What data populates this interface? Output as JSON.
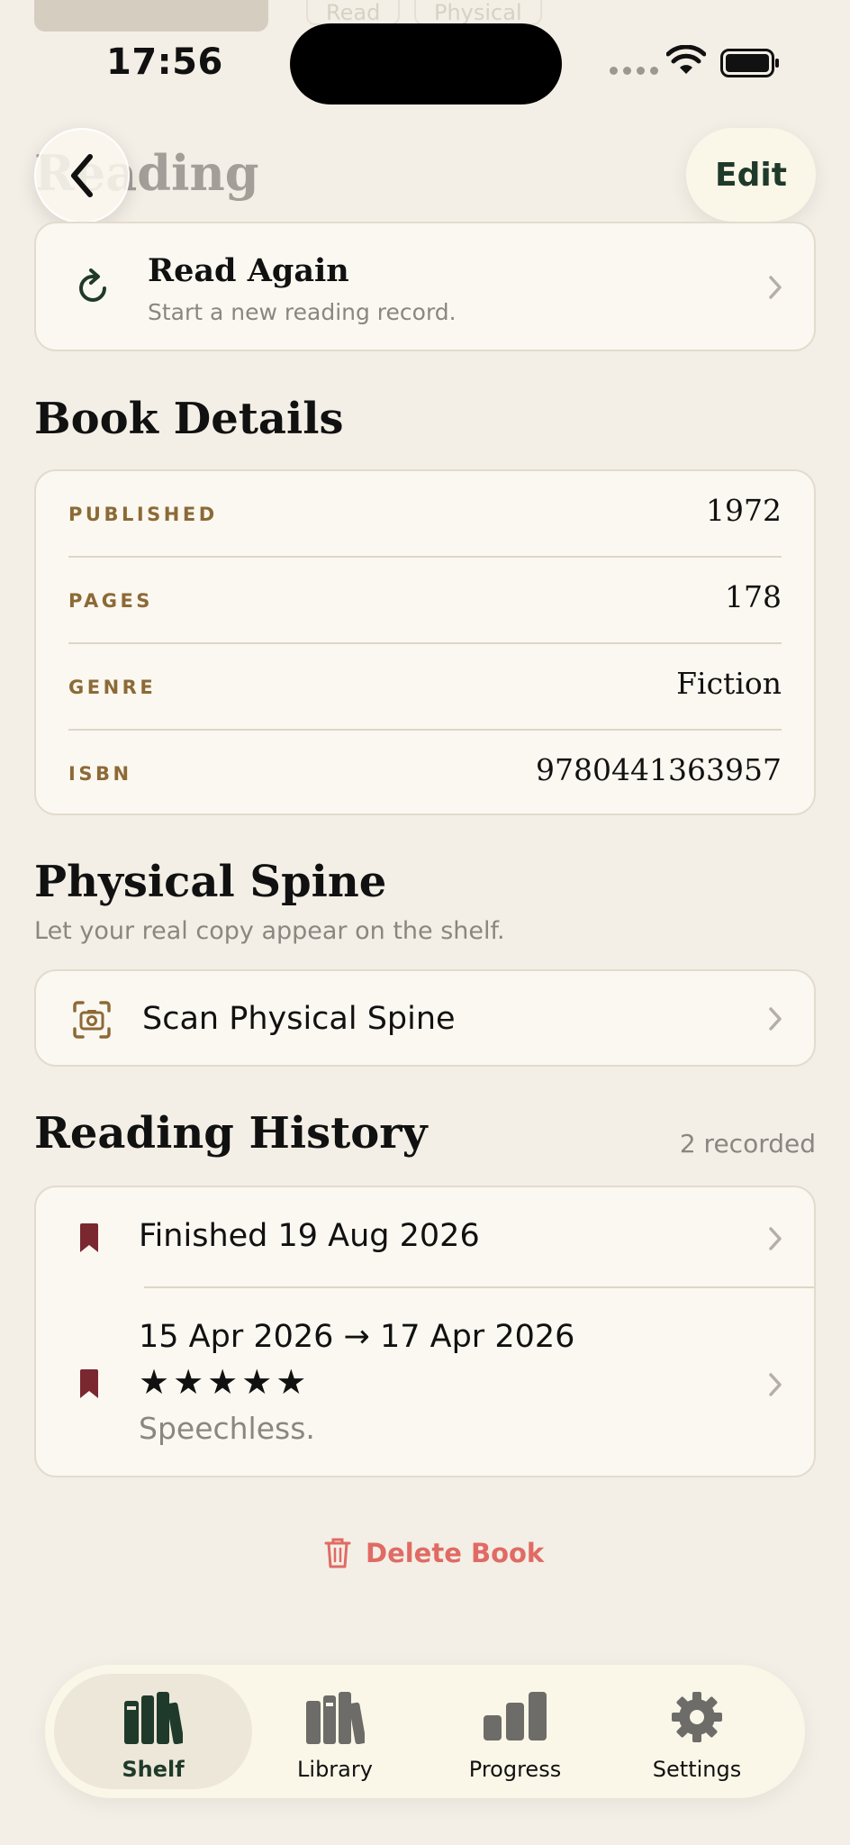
{
  "top_remnants": {
    "pill_read": "Read",
    "pill_physical": "Physical"
  },
  "status_bar": {
    "time": "17:56"
  },
  "nav": {
    "title": "Reading",
    "edit_label": "Edit",
    "back_icon": "chevron-left-icon"
  },
  "read_again": {
    "title": "Read Again",
    "subtitle": "Start a new reading record.",
    "icon": "refresh-icon"
  },
  "book_details": {
    "title": "Book Details",
    "rows": [
      {
        "label": "PUBLISHED",
        "value": "1972"
      },
      {
        "label": "PAGES",
        "value": "178"
      },
      {
        "label": "GENRE",
        "value": "Fiction"
      },
      {
        "label": "ISBN",
        "value": "9780441363957"
      }
    ]
  },
  "physical_spine": {
    "title": "Physical Spine",
    "subtitle": "Let your real copy appear on the shelf.",
    "scan_label": "Scan Physical Spine",
    "icon": "camera-scan-icon"
  },
  "reading_history": {
    "title": "Reading History",
    "count_label": "2 recorded",
    "entries": [
      {
        "text": "Finished 19 Aug 2026"
      },
      {
        "text": "15 Apr 2026 → 17 Apr 2026",
        "stars": "★★★★★",
        "rating": 5,
        "note": "Speechless."
      }
    ]
  },
  "delete_label": "Delete Book",
  "tabs": [
    {
      "label": "Shelf",
      "icon": "shelf-icon",
      "active": true
    },
    {
      "label": "Library",
      "icon": "library-icon",
      "active": false
    },
    {
      "label": "Progress",
      "icon": "progress-icon",
      "active": false
    },
    {
      "label": "Settings",
      "icon": "gear-icon",
      "active": false
    }
  ],
  "colors": {
    "background": "#F3EFE6",
    "accent_green": "#1F3A2A",
    "label_brown": "#8C6A36",
    "bookmark_red": "#7A2730",
    "delete_red": "#E06B64"
  }
}
